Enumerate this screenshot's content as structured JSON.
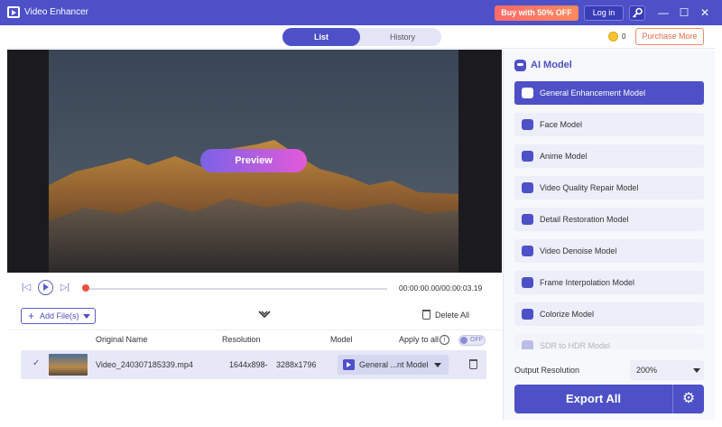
{
  "titlebar": {
    "app_title": "Video Enhancer",
    "buy_label": "Buy with 50% OFF",
    "login_label": "Log in",
    "minimize": "—",
    "maximize": "☐",
    "close": "✕"
  },
  "tabs": {
    "list": "List",
    "history": "History"
  },
  "credits": {
    "count": "0",
    "purchase_label": "Purchase More"
  },
  "player": {
    "preview_label": "Preview",
    "time": "00:00:00.00/00:00:03.19",
    "progress": 0
  },
  "filebar": {
    "add_label": "Add File(s)",
    "delete_all_label": "Delete All"
  },
  "table": {
    "headers": {
      "original_name": "Original Name",
      "resolution": "Resolution",
      "model": "Model",
      "apply_to_all": "Apply to all",
      "toggle": "OFF"
    },
    "rows": [
      {
        "name": "Video_240307185339.mp4",
        "res_from": "1644x898",
        "arrow": "→",
        "res_to": "3288x1796",
        "model": "General ...nt Model"
      }
    ]
  },
  "ai_model": {
    "title": "AI Model",
    "items": [
      {
        "label": "General Enhancement Model",
        "icon": "enhance-icon"
      },
      {
        "label": "Face Model",
        "icon": "face-icon"
      },
      {
        "label": "Anime Model",
        "icon": "anime-icon"
      },
      {
        "label": "Video Quality Repair Model",
        "icon": "repair-icon"
      },
      {
        "label": "Detail Restoration Model",
        "icon": "detail-icon"
      },
      {
        "label": "Video Denoise Model",
        "icon": "denoise-icon"
      },
      {
        "label": "Frame Interpolation Model",
        "icon": "frame-icon"
      },
      {
        "label": "Colorize Model",
        "icon": "colorize-icon"
      },
      {
        "label": "SDR to HDR Model",
        "icon": "hdr-icon"
      }
    ],
    "output_resolution_label": "Output Resolution",
    "output_resolution_value": "200%",
    "export_label": "Export All"
  },
  "colors": {
    "accent": "#4d50c6",
    "buy": "#ff6a6a",
    "purchase": "#e86a4a"
  }
}
